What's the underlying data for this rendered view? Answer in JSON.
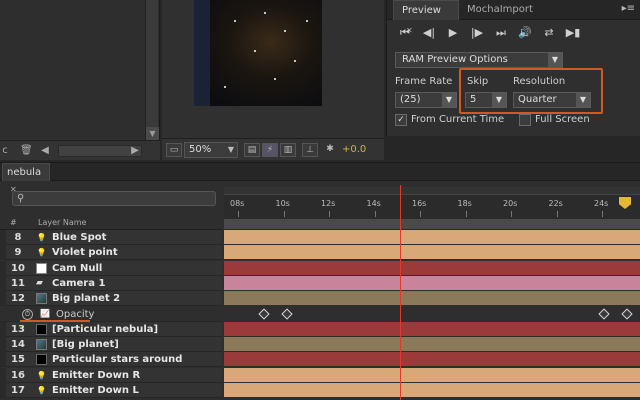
{
  "preview_panel": {
    "tabs": [
      {
        "label": "Preview"
      },
      {
        "label": "MochaImport"
      }
    ],
    "ram_preview_select": "RAM Preview Options",
    "frame_rate_label": "Frame Rate",
    "frame_rate_value": "(25)",
    "skip_label": "Skip",
    "skip_value": "5",
    "resolution_label": "Resolution",
    "resolution_value": "Quarter",
    "from_current_time_label": "From Current Time",
    "from_current_time_checked": true,
    "full_screen_label": "Full Screen",
    "full_screen_checked": false
  },
  "composition_viewer": {
    "zoom": "50%",
    "exposure": "+0.0"
  },
  "timeline": {
    "tab_label": "nebula",
    "header_hash": "#",
    "header_layer_name": "Layer Name",
    "ruler_ticks": [
      "08s",
      "10s",
      "12s",
      "14s",
      "16s",
      "18s",
      "20s",
      "22s",
      "24s"
    ],
    "layers": [
      {
        "num": "8",
        "name": "Blue Spot",
        "icon": "light-icon"
      },
      {
        "num": "9",
        "name": "Violet point",
        "icon": "light-icon"
      },
      {
        "num": "10",
        "name": "Cam Null",
        "icon": "null-icon"
      },
      {
        "num": "11",
        "name": "Camera 1",
        "icon": "camera-icon"
      },
      {
        "num": "12",
        "name": "Big planet 2",
        "icon": "footage-icon"
      },
      {
        "num": "",
        "name": "Opacity",
        "icon": "graph-icon"
      },
      {
        "num": "13",
        "name": "[Particular nebula]",
        "icon": "solid-icon"
      },
      {
        "num": "14",
        "name": "[Big planet]",
        "icon": "footage-icon"
      },
      {
        "num": "15",
        "name": "Particular stars around",
        "icon": "solid-icon"
      },
      {
        "num": "16",
        "name": "Emitter Down R",
        "icon": "light-icon"
      },
      {
        "num": "17",
        "name": "Emitter Down L",
        "icon": "light-icon"
      }
    ],
    "colors": {
      "tan": "#d8a878",
      "red": "#9b3a3a",
      "pink": "#c8849a",
      "olive": "#8b7a5a",
      "cti": "#e23a2a",
      "highlight": "#d25a1e"
    }
  }
}
